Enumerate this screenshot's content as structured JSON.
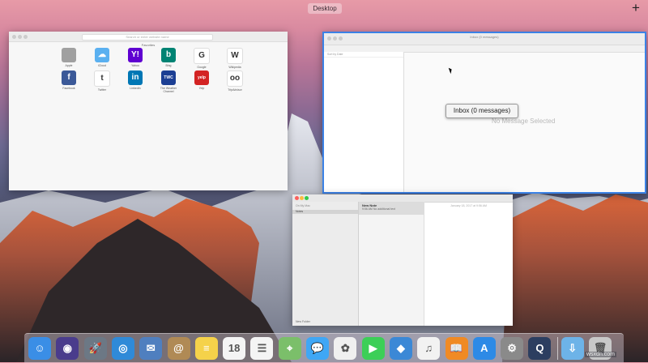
{
  "topbar": {
    "space_label": "Desktop",
    "add_label": "+"
  },
  "safari": {
    "url_placeholder": "Search or enter website name",
    "favorites_title": "Favorites",
    "favorites": [
      {
        "label": "Apple",
        "glyph": "",
        "color": "#a0a0a0",
        "icon": "apple-icon"
      },
      {
        "label": "iCloud",
        "glyph": "☁",
        "color": "#5ab0f0",
        "icon": "cloud-icon"
      },
      {
        "label": "Yahoo",
        "glyph": "Y!",
        "color": "#5f01d1",
        "icon": "yahoo-icon"
      },
      {
        "label": "Bing",
        "glyph": "b",
        "color": "#008373",
        "icon": "bing-icon"
      },
      {
        "label": "Google",
        "glyph": "G",
        "color": "#ffffff",
        "icon": "google-icon"
      },
      {
        "label": "Wikipedia",
        "glyph": "W",
        "color": "#ffffff",
        "icon": "wikipedia-icon"
      },
      {
        "label": "Facebook",
        "glyph": "f",
        "color": "#3b5998",
        "icon": "facebook-icon"
      },
      {
        "label": "Twitter",
        "glyph": "t",
        "color": "#ffffff",
        "icon": "twitter-icon"
      },
      {
        "label": "LinkedIn",
        "glyph": "in",
        "color": "#0077b5",
        "icon": "linkedin-icon"
      },
      {
        "label": "The Weather Channel",
        "glyph": "TWC",
        "color": "#1c3f94",
        "icon": "weather-icon"
      },
      {
        "label": "Yelp",
        "glyph": "yelp",
        "color": "#d32323",
        "icon": "yelp-icon"
      },
      {
        "label": "TripAdvisor",
        "glyph": "oo",
        "color": "#ffffff",
        "icon": "tripadvisor-icon"
      }
    ]
  },
  "mail": {
    "title": "Inbox (0 messages)",
    "sort_label": "Sort by Date",
    "tooltip": "Inbox (0 messages)",
    "no_selection": "No Message Selected"
  },
  "notes": {
    "account": "On My Mac",
    "folder": "Notes",
    "note_title": "New Note",
    "note_snippet": "9:56 AM  No additional text",
    "date": "January 18, 2017 at 9:56 AM",
    "footer": "New Folder"
  },
  "dock": {
    "items": [
      {
        "name": "finder-icon",
        "glyph": "☺",
        "color": "#3a8ee6"
      },
      {
        "name": "siri-icon",
        "glyph": "◉",
        "color": "#4a3c8c"
      },
      {
        "name": "launchpad-icon",
        "glyph": "🚀",
        "color": "#6c7885"
      },
      {
        "name": "safari-icon",
        "glyph": "◎",
        "color": "#2f8ad8"
      },
      {
        "name": "mail-stamp-icon",
        "glyph": "✉",
        "color": "#4f7fbf"
      },
      {
        "name": "contacts-icon",
        "glyph": "@",
        "color": "#b08a55"
      },
      {
        "name": "notes-icon",
        "glyph": "≡",
        "color": "#f5d24a"
      },
      {
        "name": "calendar-icon",
        "glyph": "18",
        "color": "#f4f4f4"
      },
      {
        "name": "reminders-icon",
        "glyph": "☰",
        "color": "#f4f4f4"
      },
      {
        "name": "maps-icon",
        "glyph": "⌖",
        "color": "#7bbf6a"
      },
      {
        "name": "messages-icon",
        "glyph": "💬",
        "color": "#3fa7f5"
      },
      {
        "name": "photos-icon",
        "glyph": "✿",
        "color": "#f0f0f0"
      },
      {
        "name": "facetime-icon",
        "glyph": "▶",
        "color": "#3ccf57"
      },
      {
        "name": "keynote-icon",
        "glyph": "◆",
        "color": "#3b88d6"
      },
      {
        "name": "itunes-icon",
        "glyph": "♫",
        "color": "#f2f2f2"
      },
      {
        "name": "ibooks-icon",
        "glyph": "📖",
        "color": "#f08a24"
      },
      {
        "name": "app-store-icon",
        "glyph": "A",
        "color": "#2d8ae6"
      },
      {
        "name": "system-preferences-icon",
        "glyph": "⚙",
        "color": "#8a8a8a"
      },
      {
        "name": "quicktime-icon",
        "glyph": "Q",
        "color": "#2c3e60"
      },
      {
        "name": "downloads-folder-icon",
        "glyph": "⇩",
        "color": "#6db3e8"
      },
      {
        "name": "trash-icon",
        "glyph": "🗑",
        "color": "#c8c8c8"
      }
    ]
  },
  "watermark": "wsxdn.com"
}
